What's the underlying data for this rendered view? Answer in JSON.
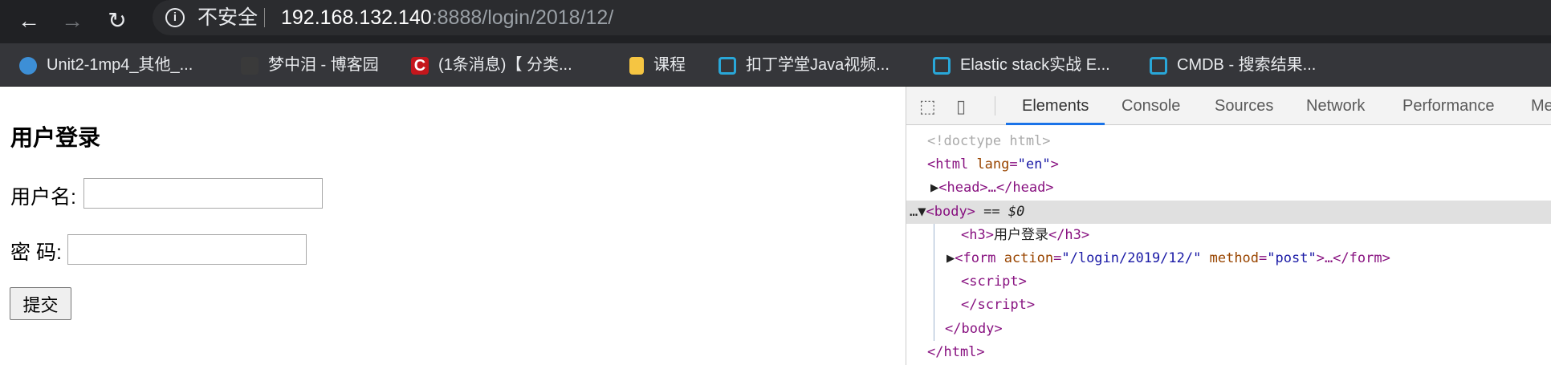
{
  "browser": {
    "back_icon": "arrow-left",
    "forward_icon": "arrow-right",
    "reload_icon": "reload",
    "security_label": "不安全",
    "url_host": "192.168.132.140",
    "url_path": ":8888/login/2018/12/",
    "bookmarks": [
      {
        "label": "Unit2-1mp4_其他_...",
        "color": "#3d8fd6"
      },
      {
        "label": "梦中泪 - 博客园",
        "color": "#3a3a3a"
      },
      {
        "label": "(1条消息)【 分类...",
        "color": "#c4161c"
      },
      {
        "label": "课程",
        "color": "#f5c542"
      },
      {
        "label": "扣丁学堂Java视频...",
        "color": "#29a7d8"
      },
      {
        "label": "Elastic stack实战 E...",
        "color": "#29a7d8"
      },
      {
        "label": "CMDB - 搜索结果...",
        "color": "#29a7d8"
      }
    ]
  },
  "page": {
    "title": "用户登录",
    "username_label": "用户名:",
    "username_value": "",
    "password_label": "密 码:",
    "password_value": "",
    "submit_label": "提交"
  },
  "devtools": {
    "tabs": [
      "Elements",
      "Console",
      "Sources",
      "Network",
      "Performance",
      "Me"
    ],
    "active_tab": "Elements",
    "tree": {
      "doctype": "<!doctype html>",
      "html_open": "<html",
      "lang_attr": "lang",
      "lang_val": "\"en\"",
      "head": "<head>…</head>",
      "body_open": "<body>",
      "body_marker": " == $0",
      "h3_open": "<h3>",
      "h3_text": "用户登录",
      "h3_close": "</h3>",
      "form_open": "<form",
      "action_attr": "action",
      "action_val": "\"/login/2019/12/\"",
      "method_attr": "method",
      "method_val": "\"post\"",
      "form_close": ">…</form>",
      "script_open": "<script>",
      "script_close": "</script>",
      "body_close": "</body>",
      "html_close": "</html>"
    }
  }
}
